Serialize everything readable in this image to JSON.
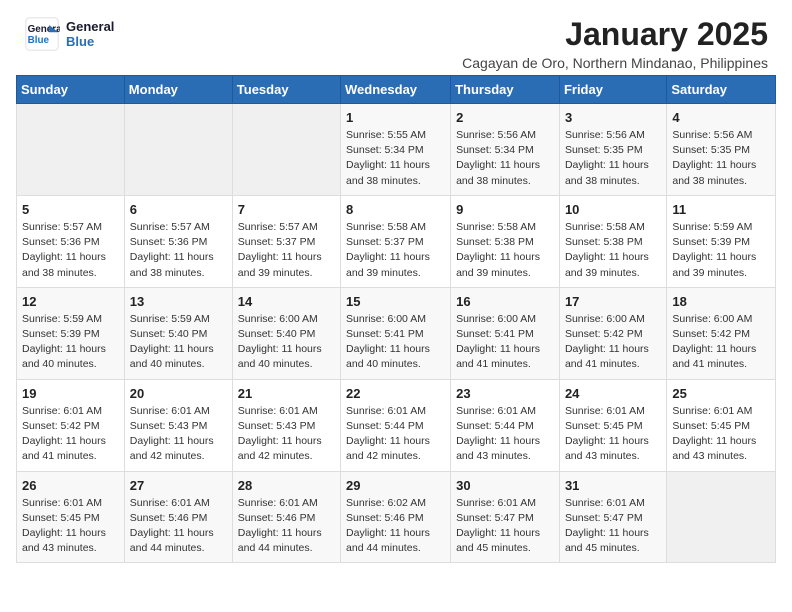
{
  "header": {
    "logo_line1": "General",
    "logo_line2": "Blue",
    "title": "January 2025",
    "subtitle": "Cagayan de Oro, Northern Mindanao, Philippines"
  },
  "weekdays": [
    "Sunday",
    "Monday",
    "Tuesday",
    "Wednesday",
    "Thursday",
    "Friday",
    "Saturday"
  ],
  "weeks": [
    [
      {
        "day": "",
        "info": ""
      },
      {
        "day": "",
        "info": ""
      },
      {
        "day": "",
        "info": ""
      },
      {
        "day": "1",
        "info": "Sunrise: 5:55 AM\nSunset: 5:34 PM\nDaylight: 11 hours and 38 minutes."
      },
      {
        "day": "2",
        "info": "Sunrise: 5:56 AM\nSunset: 5:34 PM\nDaylight: 11 hours and 38 minutes."
      },
      {
        "day": "3",
        "info": "Sunrise: 5:56 AM\nSunset: 5:35 PM\nDaylight: 11 hours and 38 minutes."
      },
      {
        "day": "4",
        "info": "Sunrise: 5:56 AM\nSunset: 5:35 PM\nDaylight: 11 hours and 38 minutes."
      }
    ],
    [
      {
        "day": "5",
        "info": "Sunrise: 5:57 AM\nSunset: 5:36 PM\nDaylight: 11 hours and 38 minutes."
      },
      {
        "day": "6",
        "info": "Sunrise: 5:57 AM\nSunset: 5:36 PM\nDaylight: 11 hours and 38 minutes."
      },
      {
        "day": "7",
        "info": "Sunrise: 5:57 AM\nSunset: 5:37 PM\nDaylight: 11 hours and 39 minutes."
      },
      {
        "day": "8",
        "info": "Sunrise: 5:58 AM\nSunset: 5:37 PM\nDaylight: 11 hours and 39 minutes."
      },
      {
        "day": "9",
        "info": "Sunrise: 5:58 AM\nSunset: 5:38 PM\nDaylight: 11 hours and 39 minutes."
      },
      {
        "day": "10",
        "info": "Sunrise: 5:58 AM\nSunset: 5:38 PM\nDaylight: 11 hours and 39 minutes."
      },
      {
        "day": "11",
        "info": "Sunrise: 5:59 AM\nSunset: 5:39 PM\nDaylight: 11 hours and 39 minutes."
      }
    ],
    [
      {
        "day": "12",
        "info": "Sunrise: 5:59 AM\nSunset: 5:39 PM\nDaylight: 11 hours and 40 minutes."
      },
      {
        "day": "13",
        "info": "Sunrise: 5:59 AM\nSunset: 5:40 PM\nDaylight: 11 hours and 40 minutes."
      },
      {
        "day": "14",
        "info": "Sunrise: 6:00 AM\nSunset: 5:40 PM\nDaylight: 11 hours and 40 minutes."
      },
      {
        "day": "15",
        "info": "Sunrise: 6:00 AM\nSunset: 5:41 PM\nDaylight: 11 hours and 40 minutes."
      },
      {
        "day": "16",
        "info": "Sunrise: 6:00 AM\nSunset: 5:41 PM\nDaylight: 11 hours and 41 minutes."
      },
      {
        "day": "17",
        "info": "Sunrise: 6:00 AM\nSunset: 5:42 PM\nDaylight: 11 hours and 41 minutes."
      },
      {
        "day": "18",
        "info": "Sunrise: 6:00 AM\nSunset: 5:42 PM\nDaylight: 11 hours and 41 minutes."
      }
    ],
    [
      {
        "day": "19",
        "info": "Sunrise: 6:01 AM\nSunset: 5:42 PM\nDaylight: 11 hours and 41 minutes."
      },
      {
        "day": "20",
        "info": "Sunrise: 6:01 AM\nSunset: 5:43 PM\nDaylight: 11 hours and 42 minutes."
      },
      {
        "day": "21",
        "info": "Sunrise: 6:01 AM\nSunset: 5:43 PM\nDaylight: 11 hours and 42 minutes."
      },
      {
        "day": "22",
        "info": "Sunrise: 6:01 AM\nSunset: 5:44 PM\nDaylight: 11 hours and 42 minutes."
      },
      {
        "day": "23",
        "info": "Sunrise: 6:01 AM\nSunset: 5:44 PM\nDaylight: 11 hours and 43 minutes."
      },
      {
        "day": "24",
        "info": "Sunrise: 6:01 AM\nSunset: 5:45 PM\nDaylight: 11 hours and 43 minutes."
      },
      {
        "day": "25",
        "info": "Sunrise: 6:01 AM\nSunset: 5:45 PM\nDaylight: 11 hours and 43 minutes."
      }
    ],
    [
      {
        "day": "26",
        "info": "Sunrise: 6:01 AM\nSunset: 5:45 PM\nDaylight: 11 hours and 43 minutes."
      },
      {
        "day": "27",
        "info": "Sunrise: 6:01 AM\nSunset: 5:46 PM\nDaylight: 11 hours and 44 minutes."
      },
      {
        "day": "28",
        "info": "Sunrise: 6:01 AM\nSunset: 5:46 PM\nDaylight: 11 hours and 44 minutes."
      },
      {
        "day": "29",
        "info": "Sunrise: 6:02 AM\nSunset: 5:46 PM\nDaylight: 11 hours and 44 minutes."
      },
      {
        "day": "30",
        "info": "Sunrise: 6:01 AM\nSunset: 5:47 PM\nDaylight: 11 hours and 45 minutes."
      },
      {
        "day": "31",
        "info": "Sunrise: 6:01 AM\nSunset: 5:47 PM\nDaylight: 11 hours and 45 minutes."
      },
      {
        "day": "",
        "info": ""
      }
    ]
  ]
}
